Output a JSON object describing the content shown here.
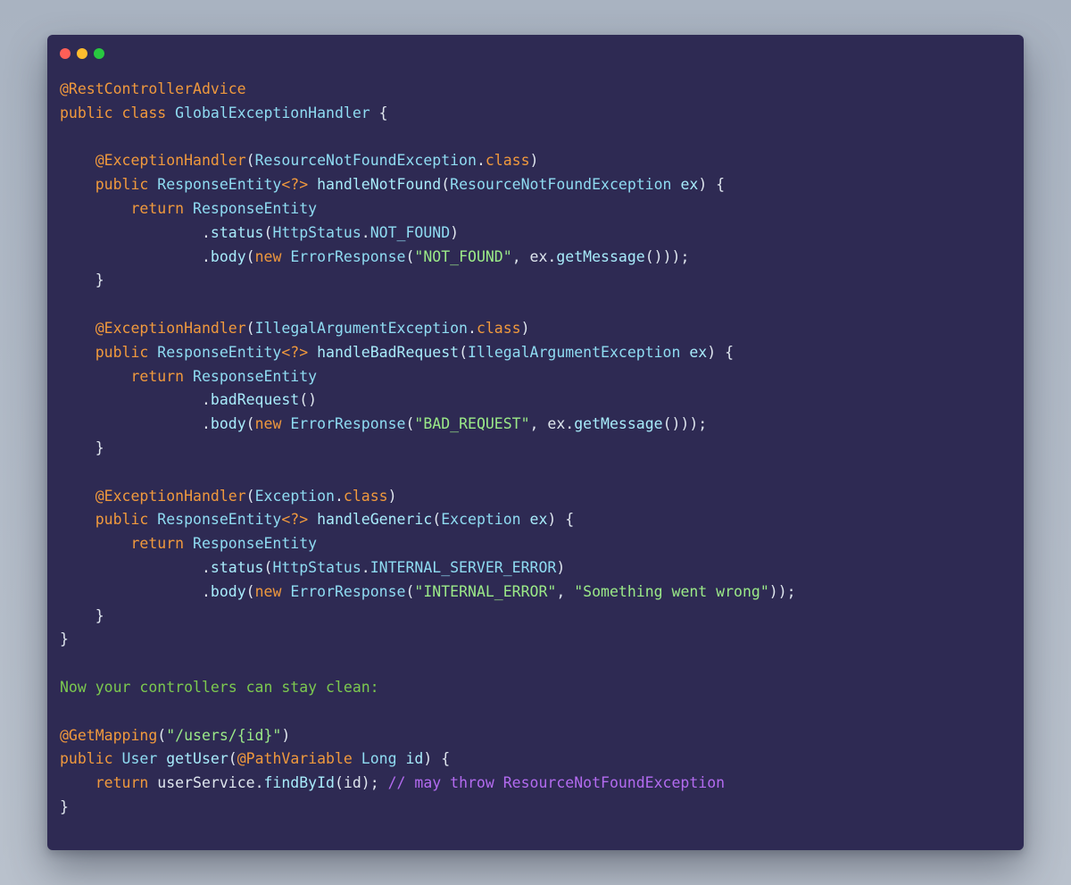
{
  "colors": {
    "background": "#2e2a53",
    "traffic_close": "#fe5f57",
    "traffic_minimize": "#febc2e",
    "traffic_zoom": "#28c840"
  },
  "window_controls": [
    "close-icon",
    "minimize-icon",
    "zoom-icon"
  ],
  "code_lines": [
    [
      [
        "ann",
        "@RestControllerAdvice"
      ]
    ],
    [
      [
        "kw",
        "public"
      ],
      [
        "pun",
        " "
      ],
      [
        "kw",
        "class"
      ],
      [
        "pun",
        " "
      ],
      [
        "type",
        "GlobalExceptionHandler"
      ],
      [
        "pun",
        " {"
      ]
    ],
    [],
    [
      [
        "pun",
        "    "
      ],
      [
        "ann",
        "@ExceptionHandler"
      ],
      [
        "pun",
        "("
      ],
      [
        "type",
        "ResourceNotFoundException"
      ],
      [
        "pun",
        "."
      ],
      [
        "kw",
        "class"
      ],
      [
        "pun",
        ")"
      ]
    ],
    [
      [
        "pun",
        "    "
      ],
      [
        "kw",
        "public"
      ],
      [
        "pun",
        " "
      ],
      [
        "type",
        "ResponseEntity"
      ],
      [
        "kw",
        "<?>"
      ],
      [
        "pun",
        " "
      ],
      [
        "fn",
        "handleNotFound"
      ],
      [
        "pun",
        "("
      ],
      [
        "type",
        "ResourceNotFoundException"
      ],
      [
        "pun",
        " "
      ],
      [
        "fn",
        "ex"
      ],
      [
        "pun",
        ") {"
      ]
    ],
    [
      [
        "pun",
        "        "
      ],
      [
        "kw",
        "return"
      ],
      [
        "pun",
        " "
      ],
      [
        "type",
        "ResponseEntity"
      ]
    ],
    [
      [
        "pun",
        "                ."
      ],
      [
        "fn",
        "status"
      ],
      [
        "pun",
        "("
      ],
      [
        "type",
        "HttpStatus"
      ],
      [
        "pun",
        "."
      ],
      [
        "type",
        "NOT_FOUND"
      ],
      [
        "pun",
        ")"
      ]
    ],
    [
      [
        "pun",
        "                ."
      ],
      [
        "fn",
        "body"
      ],
      [
        "pun",
        "("
      ],
      [
        "kw",
        "new"
      ],
      [
        "pun",
        " "
      ],
      [
        "type",
        "ErrorResponse"
      ],
      [
        "pun",
        "("
      ],
      [
        "str",
        "\"NOT_FOUND\""
      ],
      [
        "pun",
        ", ex."
      ],
      [
        "fn",
        "getMessage"
      ],
      [
        "pun",
        "()));"
      ]
    ],
    [
      [
        "pun",
        "    }"
      ]
    ],
    [],
    [
      [
        "pun",
        "    "
      ],
      [
        "ann",
        "@ExceptionHandler"
      ],
      [
        "pun",
        "("
      ],
      [
        "type",
        "IllegalArgumentException"
      ],
      [
        "pun",
        "."
      ],
      [
        "kw",
        "class"
      ],
      [
        "pun",
        ")"
      ]
    ],
    [
      [
        "pun",
        "    "
      ],
      [
        "kw",
        "public"
      ],
      [
        "pun",
        " "
      ],
      [
        "type",
        "ResponseEntity"
      ],
      [
        "kw",
        "<?>"
      ],
      [
        "pun",
        " "
      ],
      [
        "fn",
        "handleBadRequest"
      ],
      [
        "pun",
        "("
      ],
      [
        "type",
        "IllegalArgumentException"
      ],
      [
        "pun",
        " "
      ],
      [
        "fn",
        "ex"
      ],
      [
        "pun",
        ") {"
      ]
    ],
    [
      [
        "pun",
        "        "
      ],
      [
        "kw",
        "return"
      ],
      [
        "pun",
        " "
      ],
      [
        "type",
        "ResponseEntity"
      ]
    ],
    [
      [
        "pun",
        "                ."
      ],
      [
        "fn",
        "badRequest"
      ],
      [
        "pun",
        "()"
      ]
    ],
    [
      [
        "pun",
        "                ."
      ],
      [
        "fn",
        "body"
      ],
      [
        "pun",
        "("
      ],
      [
        "kw",
        "new"
      ],
      [
        "pun",
        " "
      ],
      [
        "type",
        "ErrorResponse"
      ],
      [
        "pun",
        "("
      ],
      [
        "str",
        "\"BAD_REQUEST\""
      ],
      [
        "pun",
        ", ex."
      ],
      [
        "fn",
        "getMessage"
      ],
      [
        "pun",
        "()));"
      ]
    ],
    [
      [
        "pun",
        "    }"
      ]
    ],
    [],
    [
      [
        "pun",
        "    "
      ],
      [
        "ann",
        "@ExceptionHandler"
      ],
      [
        "pun",
        "("
      ],
      [
        "type",
        "Exception"
      ],
      [
        "pun",
        "."
      ],
      [
        "kw",
        "class"
      ],
      [
        "pun",
        ")"
      ]
    ],
    [
      [
        "pun",
        "    "
      ],
      [
        "kw",
        "public"
      ],
      [
        "pun",
        " "
      ],
      [
        "type",
        "ResponseEntity"
      ],
      [
        "kw",
        "<?>"
      ],
      [
        "pun",
        " "
      ],
      [
        "fn",
        "handleGeneric"
      ],
      [
        "pun",
        "("
      ],
      [
        "type",
        "Exception"
      ],
      [
        "pun",
        " "
      ],
      [
        "fn",
        "ex"
      ],
      [
        "pun",
        ") {"
      ]
    ],
    [
      [
        "pun",
        "        "
      ],
      [
        "kw",
        "return"
      ],
      [
        "pun",
        " "
      ],
      [
        "type",
        "ResponseEntity"
      ]
    ],
    [
      [
        "pun",
        "                ."
      ],
      [
        "fn",
        "status"
      ],
      [
        "pun",
        "("
      ],
      [
        "type",
        "HttpStatus"
      ],
      [
        "pun",
        "."
      ],
      [
        "type",
        "INTERNAL_SERVER_ERROR"
      ],
      [
        "pun",
        ")"
      ]
    ],
    [
      [
        "pun",
        "                ."
      ],
      [
        "fn",
        "body"
      ],
      [
        "pun",
        "("
      ],
      [
        "kw",
        "new"
      ],
      [
        "pun",
        " "
      ],
      [
        "type",
        "ErrorResponse"
      ],
      [
        "pun",
        "("
      ],
      [
        "str",
        "\"INTERNAL_ERROR\""
      ],
      [
        "pun",
        ", "
      ],
      [
        "str",
        "\"Something went wrong\""
      ],
      [
        "pun",
        "));"
      ]
    ],
    [
      [
        "pun",
        "    }"
      ]
    ],
    [
      [
        "pun",
        "}"
      ]
    ],
    [],
    [
      [
        "prose",
        "Now your controllers can stay clean:"
      ]
    ],
    [],
    [
      [
        "ann",
        "@GetMapping"
      ],
      [
        "pun",
        "("
      ],
      [
        "str",
        "\"/users/{id}\""
      ],
      [
        "pun",
        ")"
      ]
    ],
    [
      [
        "kw",
        "public"
      ],
      [
        "pun",
        " "
      ],
      [
        "type",
        "User"
      ],
      [
        "pun",
        " "
      ],
      [
        "fn",
        "getUser"
      ],
      [
        "pun",
        "("
      ],
      [
        "ann",
        "@PathVariable"
      ],
      [
        "pun",
        " "
      ],
      [
        "type",
        "Long"
      ],
      [
        "pun",
        " "
      ],
      [
        "fn",
        "id"
      ],
      [
        "pun",
        ") {"
      ]
    ],
    [
      [
        "pun",
        "    "
      ],
      [
        "kw",
        "return"
      ],
      [
        "pun",
        " userService."
      ],
      [
        "fn",
        "findById"
      ],
      [
        "pun",
        "(id); "
      ],
      [
        "com",
        "// may throw ResourceNotFoundException"
      ]
    ],
    [
      [
        "pun",
        "}"
      ]
    ]
  ]
}
